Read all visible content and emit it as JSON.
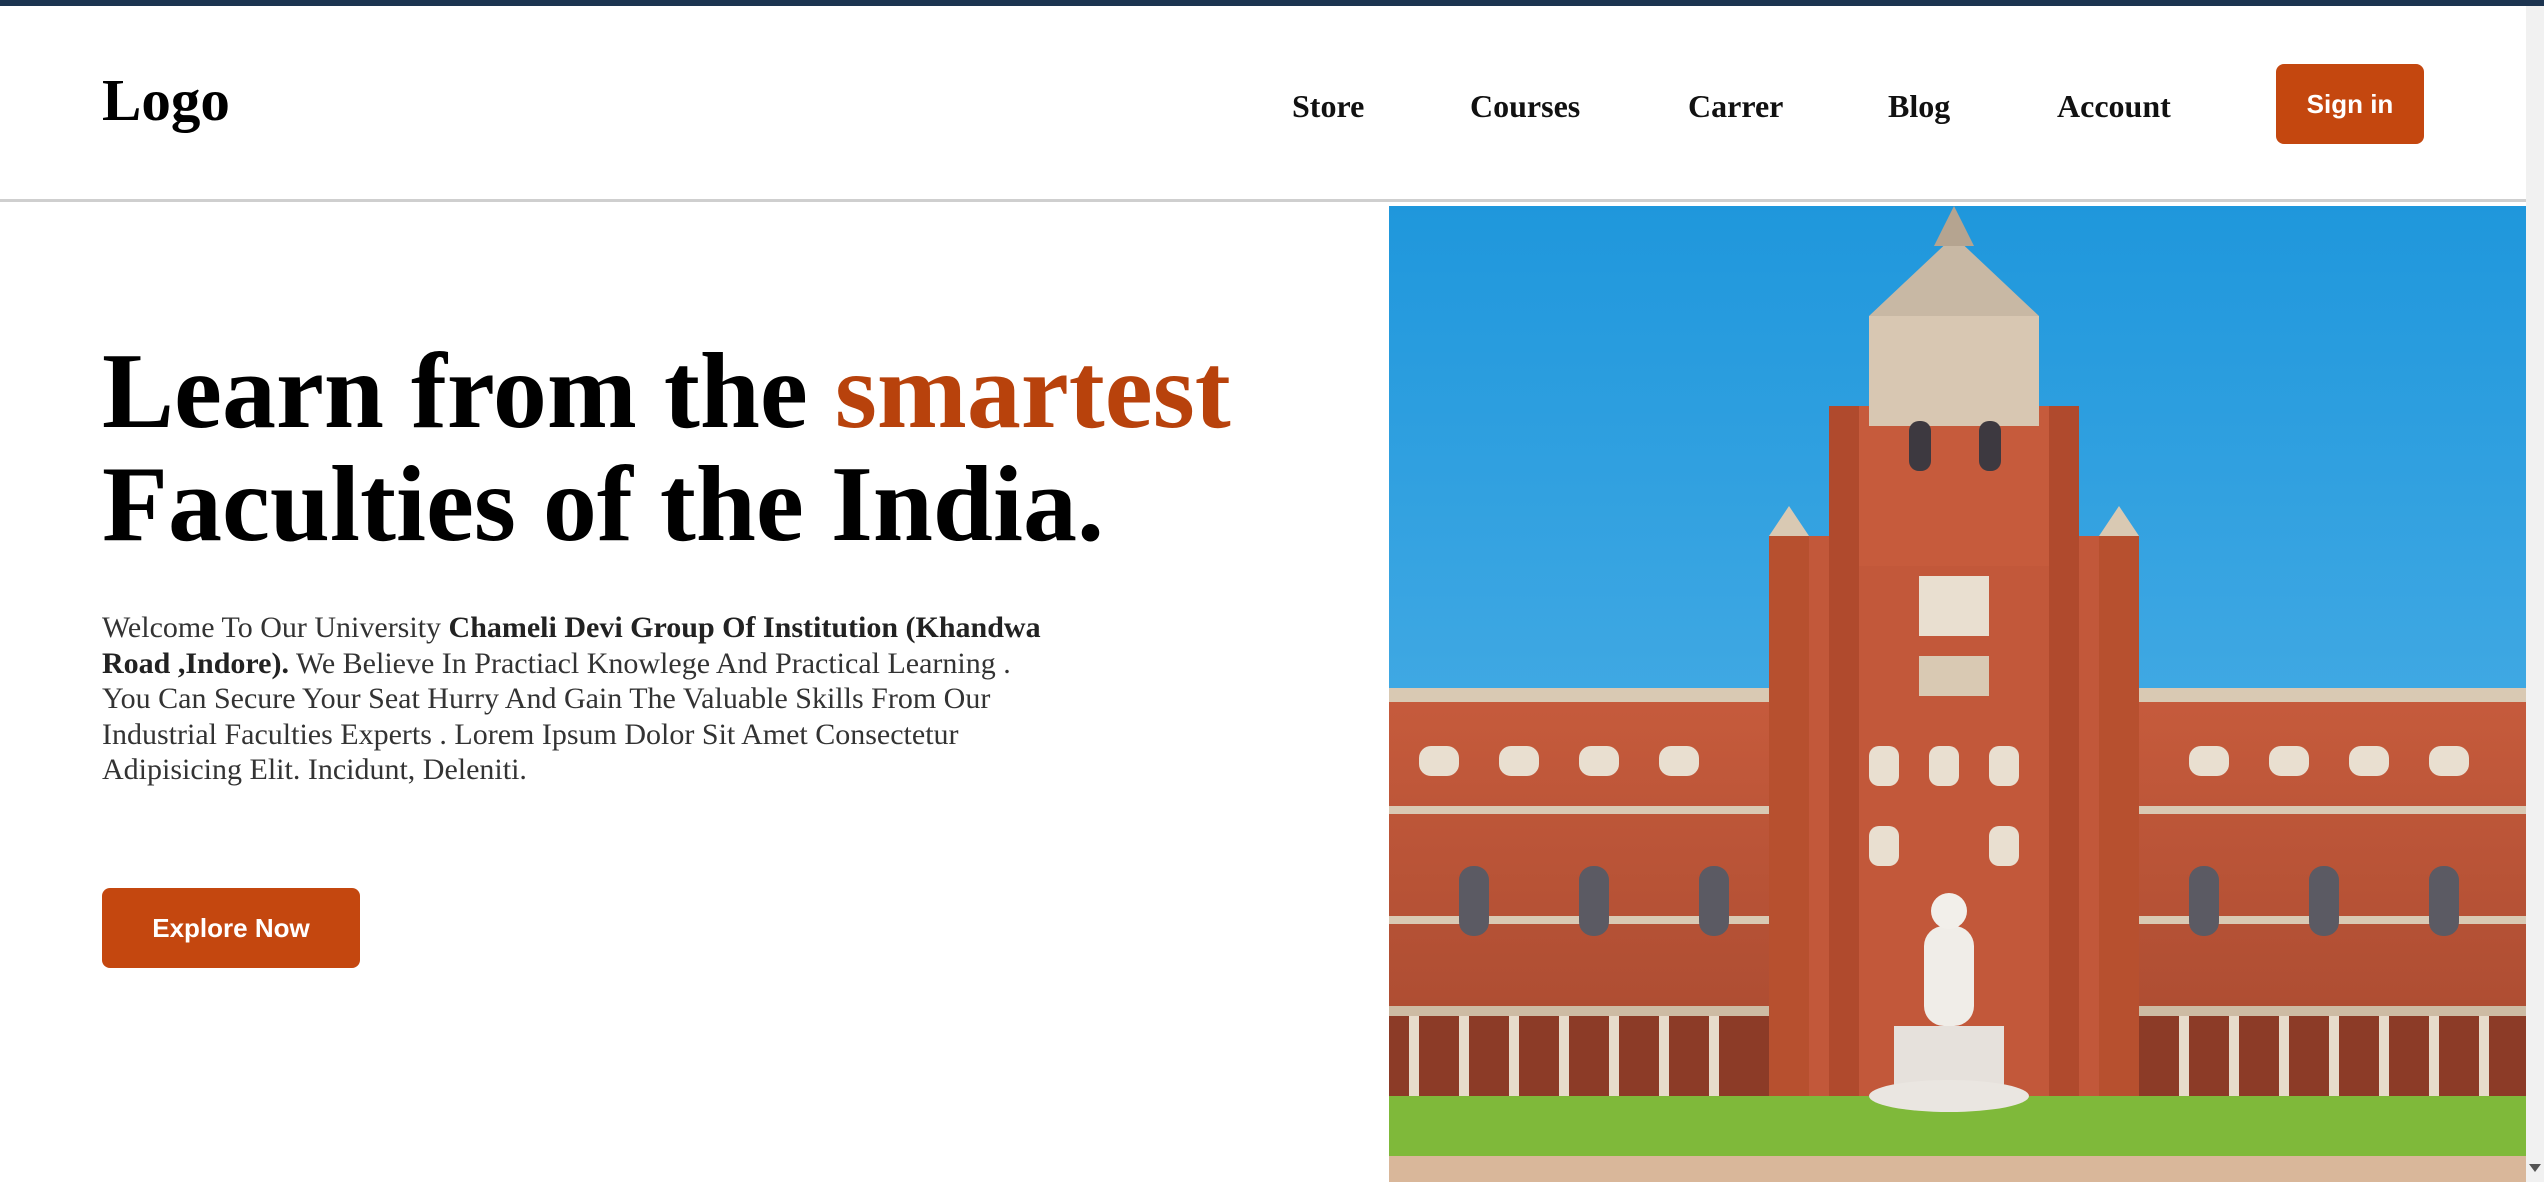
{
  "header": {
    "logo": "Logo",
    "nav": [
      {
        "label": "Store"
      },
      {
        "label": "Courses"
      },
      {
        "label": "Carrer"
      },
      {
        "label": "Blog"
      },
      {
        "label": "Account"
      }
    ],
    "signin_label": "Sign in"
  },
  "hero": {
    "title_part1": "Learn from the ",
    "title_accent": "smartest",
    "title_line2": "Faculties of the India.",
    "desc_intro": "Welcome To Our University ",
    "desc_bold": "Chameli Devi Group Of Institution (Khandwa Road ,Indore).",
    "desc_rest": " We Believe In Practiacl Knowlege And Practical Learning . You Can Secure Your Seat Hurry And Gain The Valuable Skills From Our Industrial Faculties Experts . Lorem Ipsum Dolor Sit Amet Consectetur Adipisicing Elit. Incidunt, Deleniti.",
    "cta_label": "Explore Now"
  },
  "colors": {
    "accent": "#c4470f",
    "heading_accent": "#b8420c",
    "top_strip": "#1c3450"
  }
}
